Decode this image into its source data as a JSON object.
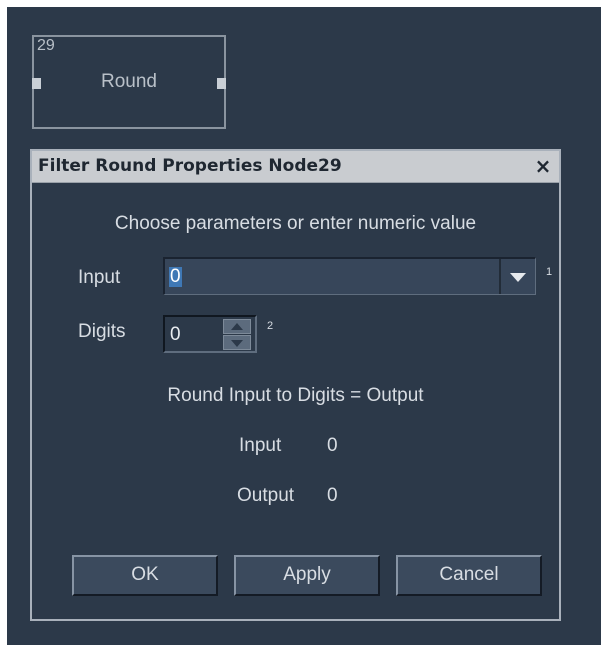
{
  "node": {
    "id": "29",
    "label": "Round"
  },
  "dialog": {
    "title": "Filter Round Properties Node29",
    "close_glyph": "×",
    "instruction": "Choose parameters or enter numeric value",
    "input_field": {
      "label": "Input",
      "value": "0",
      "index": "1"
    },
    "digits_field": {
      "label": "Digits",
      "value": "0",
      "index": "2"
    },
    "formula": "Round Input to Digits = Output",
    "readout": {
      "input_label": "Input",
      "input_value": "0",
      "output_label": "Output",
      "output_value": "0"
    },
    "buttons": {
      "ok": "OK",
      "apply": "Apply",
      "cancel": "Cancel"
    }
  },
  "icons": {
    "combo_arrow": "chevron-down-icon",
    "spin_up": "arrow-up-icon",
    "spin_down": "arrow-down-icon",
    "close": "close-icon"
  },
  "colors": {
    "canvas_bg": "#2c3949",
    "titlebar_bg": "#c9ccd0",
    "selection": "#3f78b5",
    "text": "#d8dde3"
  }
}
